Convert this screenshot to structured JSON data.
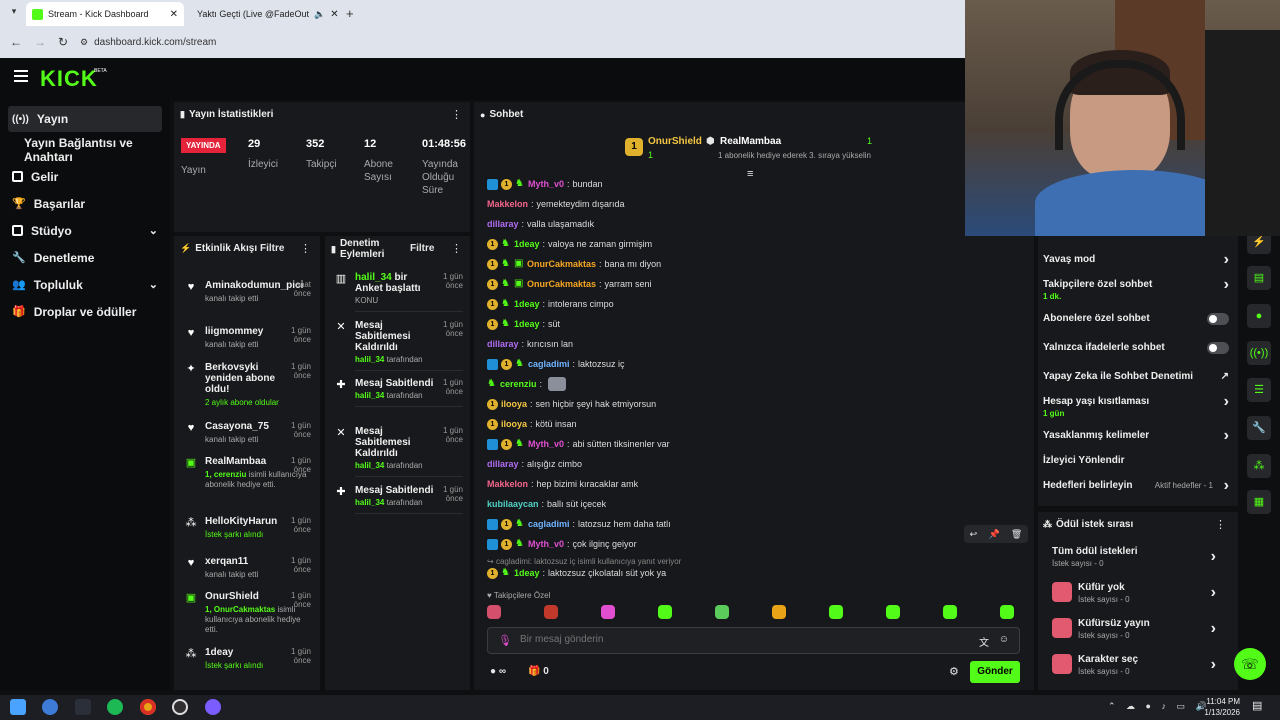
{
  "browser": {
    "tabs": [
      {
        "label": "Stream - Kick Dashboard",
        "active": true
      },
      {
        "label": "Yaktı Geçti (Live @FadeOut",
        "active": false
      }
    ],
    "url": "dashboard.kick.com/stream"
  },
  "header": {
    "logo": "KICK",
    "beta": "BETA"
  },
  "sidebar": {
    "items": [
      {
        "label": "Yayın",
        "icon": "signal-icon"
      },
      {
        "label": "Yayın Bağlantısı ve Anahtarı",
        "icon": "key-icon"
      },
      {
        "label": "Gelir",
        "icon": "money-icon"
      },
      {
        "label": "Başarılar",
        "icon": "trophy-icon"
      },
      {
        "label": "Stüdyo",
        "icon": "studio-icon"
      },
      {
        "label": "Denetleme",
        "icon": "wrench-icon"
      },
      {
        "label": "Topluluk",
        "icon": "community-icon"
      },
      {
        "label": "Droplar ve ödüller",
        "icon": "gift-icon"
      }
    ]
  },
  "stats": {
    "title": "Yayın İstatistikleri",
    "live_badge": "YAYINDA",
    "live_label": "Yayın",
    "viewers": "29",
    "viewers_label": "İzleyici",
    "followers": "352",
    "followers_label": "Takipçi",
    "subs": "12",
    "subs_label": "Abone Sayısı",
    "uptime": "01:48:56",
    "uptime_label": "Yayında Olduğu Süre"
  },
  "activity": {
    "title": "Etkinlik Akışı",
    "filter": "Filtre",
    "items": [
      {
        "name": "Aminakodumun_pici",
        "sub": "kanalı takip etti",
        "time": "saat önce",
        "icon": "heart-icon"
      },
      {
        "name": "liigmommey",
        "sub": "kanalı takip etti",
        "time": "1 gün önce",
        "icon": "heart-icon"
      },
      {
        "name": "Berkovsyki yeniden abone oldu!",
        "sub": "2 aylık abone oldular",
        "time": "1 gün önce",
        "icon": "sparkle-icon"
      },
      {
        "name": "Casayona_75",
        "sub": "kanalı takip etti",
        "time": "1 gün önce",
        "icon": "heart-icon"
      },
      {
        "name": "RealMambaa",
        "sub_highlight": "1, cerenziu",
        "sub": "isimli kullanıcıya abonelik hediye etti.",
        "time": "1 gün önce",
        "icon": "gift-icon"
      },
      {
        "name": "HelloKityHarun",
        "sub": "İstek şarkı alındı",
        "time": "1 gün önce",
        "icon": "dots-icon"
      },
      {
        "name": "xerqan11",
        "sub": "kanalı takip etti",
        "time": "1 gün önce",
        "icon": "heart-icon"
      },
      {
        "name": "OnurShield",
        "sub_highlight": "1, OnurCakmaktas",
        "sub": "isimli kullanıcıya abonelik hediye etti.",
        "time": "1 gün önce",
        "icon": "gift-icon"
      },
      {
        "name": "1deay",
        "sub": "İstek şarkı alındı",
        "time": "1 gün önce",
        "icon": "dots-icon"
      }
    ]
  },
  "mod_actions": {
    "title": "Denetim Eylemleri",
    "filter": "Filtre",
    "items": [
      {
        "name_user": "halil_34",
        "name": "bir Anket başlattı",
        "sub": "KONU",
        "time": "1 gün önce",
        "icon": "chart-icon"
      },
      {
        "name": "Mesaj Sabitlemesi Kaldırıldı",
        "sub_user": "halil_34",
        "sub": "tarafından",
        "time": "1 gün önce",
        "icon": "unpin-icon"
      },
      {
        "name": "Mesaj Sabitlendi",
        "sub_user": "halil_34",
        "sub": "tarafından",
        "time": "1 gün önce",
        "icon": "pin-icon"
      },
      {
        "name": "Mesaj Sabitlemesi Kaldırıldı",
        "sub_user": "halil_34",
        "sub": "tarafından",
        "time": "1 gün önce",
        "icon": "unpin-icon"
      },
      {
        "name": "Mesaj Sabitlendi",
        "sub_user": "halil_34",
        "sub": "tarafından",
        "time": "1 gün önce",
        "icon": "pin-icon"
      }
    ]
  },
  "chat": {
    "title": "Sohbet",
    "leader1": {
      "rank": "1",
      "name": "OnurShield",
      "count": "1"
    },
    "leader2": {
      "name": "RealMambaa",
      "count": "1",
      "note": "1 abonelik hediye ederek 3. sıraya yükselin"
    },
    "messages": [
      {
        "user": "Myth_v0",
        "color": "#e14fd0",
        "text": "bundan"
      },
      {
        "user": "Makkelon",
        "color": "#f2668b",
        "text": "yemekteydim dışarıda"
      },
      {
        "user": "dillaray",
        "color": "#b06cf0",
        "text": "valla ulaşamadık"
      },
      {
        "user": "1deay",
        "color": "#53fc18",
        "text": "valoya ne zaman girmişim"
      },
      {
        "user": "OnurCakmaktas",
        "color": "#f5a623",
        "text": "bana mı diyon"
      },
      {
        "user": "OnurCakmaktas",
        "color": "#f5a623",
        "text": "yarram seni"
      },
      {
        "user": "1deay",
        "color": "#53fc18",
        "text": "intolerans cimpo"
      },
      {
        "user": "1deay",
        "color": "#53fc18",
        "text": "süt"
      },
      {
        "user": "dillaray",
        "color": "#b06cf0",
        "text": "kırıcısın lan"
      },
      {
        "user": "cagladimi",
        "color": "#6fb4ff",
        "text": "laktozsuz iç"
      },
      {
        "user": "cerenziu",
        "color": "#53fc18",
        "text": ""
      },
      {
        "user": "ilooya",
        "color": "#f5c744",
        "text": "sen hiçbir şeyi hak etmiyorsun"
      },
      {
        "user": "ilooya",
        "color": "#f5c744",
        "text": "kötü insan"
      },
      {
        "user": "Myth_v0",
        "color": "#e14fd0",
        "text": "abi sütten tiksinenler var"
      },
      {
        "user": "dillaray",
        "color": "#b06cf0",
        "text": "alışığız cimbo"
      },
      {
        "user": "Makkelon",
        "color": "#f2668b",
        "text": "hep bizimi kıracaklar amk"
      },
      {
        "user": "kubilaaycan",
        "color": "#4fd1c5",
        "text": "ballı süt içecek"
      },
      {
        "user": "cagladimi",
        "color": "#6fb4ff",
        "text": "latozsuz hem daha tatlı"
      },
      {
        "user": "Myth_v0",
        "color": "#e14fd0",
        "text": "çok ilginç geiyor"
      }
    ],
    "reply_ref": "cagladimi: laktozsuz iç isimli kullanıcıya yanıt veriyor",
    "reply_user": "1deay",
    "reply_text": "laktozsuz çikolatalı süt yok ya",
    "emote_section": "Takipçilere Özel",
    "input_placeholder": "Bir mesaj gönderin",
    "points": "0",
    "send": "Gönder"
  },
  "chat_settings": {
    "items": [
      {
        "label": "Yavaş mod",
        "type": "chevron"
      },
      {
        "label": "Takipçilere özel sohbet",
        "sub": "1 dk.",
        "type": "chevron"
      },
      {
        "label": "Abonelere özel sohbet",
        "type": "toggle"
      },
      {
        "label": "Yalnızca ifadelerle sohbet",
        "type": "toggle"
      },
      {
        "label": "Yapay Zeka ile Sohbet Denetimi",
        "type": "external"
      },
      {
        "label": "Hesap yaşı kısıtlaması",
        "sub": "1 gün",
        "type": "chevron"
      },
      {
        "label": "Yasaklanmış kelimeler",
        "type": "chevron"
      },
      {
        "label": "İzleyici Yönlendir",
        "type": "none"
      },
      {
        "label": "Hedefleri belirleyin",
        "extra": "Aktif hedefler - 1",
        "type": "chevron"
      }
    ]
  },
  "rewards": {
    "title": "Ödül istek sırası",
    "items": [
      {
        "label": "Tüm ödül istekleri",
        "sub": "İstek sayısı - 0"
      },
      {
        "label": "Küfür yok",
        "sub": "İstek sayısı - 0"
      },
      {
        "label": "Küfürsüz yayın",
        "sub": "İstek sayısı - 0"
      },
      {
        "label": "Karakter seç",
        "sub": "İstek sayısı - 0"
      }
    ]
  },
  "taskbar": {
    "time": "11:04 PM",
    "date": "1/13/2026"
  }
}
